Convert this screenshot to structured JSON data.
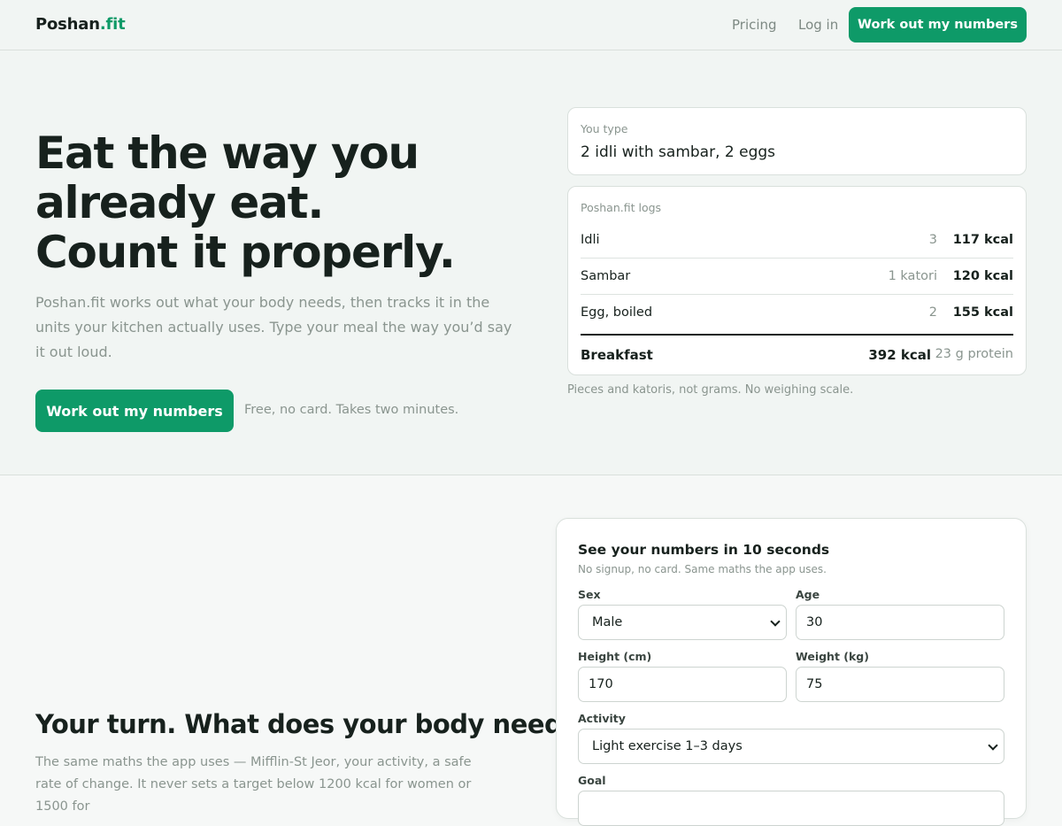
{
  "header": {
    "logo_main": "Poshan",
    "logo_accent": ".fit",
    "nav": {
      "pricing": "Pricing",
      "login": "Log in",
      "cta": "Work out my numbers"
    }
  },
  "hero": {
    "title_lines": [
      "Eat the way you",
      "already eat.",
      "Count it properly."
    ],
    "subtitle": "Poshan.fit works out what your body needs, then tracks it in the units your kitchen actually uses. Type your meal the way you’d say it out loud.",
    "cta": "Work out my numbers",
    "note": "Free, no card. Takes two minutes.",
    "type_card": {
      "label": "You type",
      "value": "2 idli with sambar, 2 eggs"
    },
    "log_card": {
      "label": "Poshan.fit logs",
      "rows": [
        {
          "name": "Idli",
          "qty": "3",
          "kcal": "117 kcal"
        },
        {
          "name": "Sambar",
          "qty": "1 katori",
          "kcal": "120 kcal"
        },
        {
          "name": "Egg, boiled",
          "qty": "2",
          "kcal": "155 kcal"
        }
      ],
      "total": {
        "name": "Breakfast",
        "kcal": "392 kcal",
        "protein": "23 g protein"
      }
    },
    "caption": "Pieces and katoris, not grams. No weighing scale."
  },
  "section2": {
    "title": "Your turn. What does your body need?",
    "body": "The same maths the app uses — Mifflin-St Jeor, your activity, a safe rate of change. It never sets a target below 1200 kcal for women or 1500 for",
    "calculator": {
      "title": "See your numbers in 10 seconds",
      "subtitle": "No signup, no card. Same maths the app uses.",
      "fields": {
        "sex": {
          "label": "Sex",
          "value": "Male"
        },
        "age": {
          "label": "Age",
          "value": "30"
        },
        "height": {
          "label": "Height (cm)",
          "value": "170"
        },
        "weight": {
          "label": "Weight (kg)",
          "value": "75"
        },
        "activity": {
          "label": "Activity",
          "value": "Light exercise 1–3 days"
        },
        "goal": {
          "label": "Goal",
          "value": ""
        }
      }
    }
  },
  "colors": {
    "accent": "#0e9a68",
    "text": "#17211d",
    "muted": "#8a958f",
    "hero_bg": "#f1f5f3"
  }
}
